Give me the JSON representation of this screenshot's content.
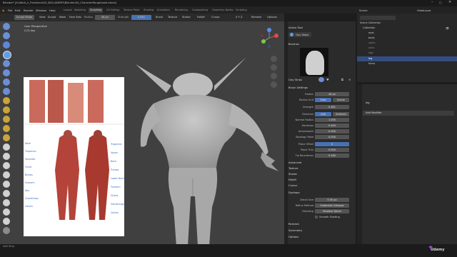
{
  "titlebar": {
    "title": "Blender* [A:\\Work_n_Freelance\\00_SKILLADEMY\\Blender\\04_CharacterRough\\bold.blend]"
  },
  "menubar": {
    "items": [
      "File",
      "Edit",
      "Render",
      "Window",
      "Help"
    ],
    "workspaces": [
      "Layout",
      "Modeling",
      "Sculpting",
      "UV Editing",
      "Texture Paint",
      "Shading",
      "Animation",
      "Rendering",
      "Compositing",
      "Geometry Nodes",
      "Scripting"
    ],
    "active_workspace": "Sculpting",
    "scene_label": "Scene",
    "viewlayer_label": "ViewLayer"
  },
  "header": {
    "mode": "Sculpt Mode",
    "view": "View",
    "sculpt": "Sculpt",
    "mask": "Mask",
    "face_sets": "Face Sets",
    "radius_label": "Radius",
    "radius_value": "46 px",
    "strength_label": "Strength",
    "strength_value": "0.481",
    "brush": "Brush",
    "texture": "Texture",
    "stroke": "Stroke",
    "falloff": "Falloff",
    "cursor": "Cursor",
    "xyz": "X Y Z",
    "remesh": "Remesh",
    "options": "Options"
  },
  "viewport": {
    "view_name": "User Perspective",
    "object_name": "(13) leg"
  },
  "props": {
    "active_tool": "Active Tool",
    "tool_name": "Clay Strips",
    "brushes_section": "Brushes",
    "brush_name": "Clay Strips",
    "brush_settings": "Brush Settings",
    "radius_label": "Radius",
    "radius_value": "46 px",
    "radius_unit_label": "Radius Unit",
    "radius_unit_view": "View",
    "radius_unit_scene": "Scene",
    "strength_label": "Strength",
    "strength_value": "0.481",
    "direction_label": "Direction",
    "direction_add": "Add",
    "direction_subtract": "Subtract",
    "normal_radius_label": "Normal Radius",
    "normal_radius_value": "1.000",
    "hardness_label": "Hardness",
    "hardness_value": "0.400",
    "autosmooth_label": "Autosmooth",
    "autosmooth_value": "0.000",
    "topology_rake_label": "Topology Rake",
    "topology_rake_value": "0.000",
    "plane_offset_label": "Plane Offset",
    "plane_offset_value": "0",
    "plane_trim_label": "Plane Trim",
    "plane_trim_value": "0.500",
    "tip_roundness_label": "Tip Roundness",
    "tip_roundness_value": "0.180",
    "advanced": "Advanced",
    "texture": "Texture",
    "stroke": "Stroke",
    "falloff": "Falloff",
    "cursor": "Cursor",
    "dyntopo": "Dyntopo",
    "detail_size_label": "Detail Size",
    "detail_size_value": "5.00 px",
    "refine_method_label": "Refine Method",
    "refine_method_value": "Subdivide Collapse",
    "detailing_label": "Detailing",
    "detailing_value": "Relative Detail",
    "smooth_shading": "Smooth Shading",
    "remesh": "Remesh",
    "symmetry": "Symmetry",
    "options": "Options"
  },
  "outliner": {
    "scene_collection": "Scene Collection",
    "items": [
      {
        "name": "Collection"
      },
      {
        "name": "eyeL"
      },
      {
        "name": "body"
      },
      {
        "name": "spine"
      },
      {
        "name": "neck"
      },
      {
        "name": "legL"
      },
      {
        "name": "leg"
      },
      {
        "name": "torso"
      }
    ]
  },
  "modifiers": {
    "object_name": "leg",
    "add_modifier": "Add Modifier"
  },
  "statusbar": {
    "left_text": "Add Strip",
    "brand": "Udemy"
  },
  "reference": {
    "labels_left": [
      "Neck",
      "Trapezius",
      "Shoulder",
      "Chest",
      "Biceps",
      "Forearm",
      "Abs",
      "Quadriceps",
      "Calves"
    ],
    "labels_right": [
      "Trapezius",
      "Upper Back",
      "Triceps",
      "Lower Back",
      "Forearm",
      "Glutes",
      "Hamstrings",
      "Calves"
    ]
  },
  "colors": {
    "accent": "#4772b3",
    "active_workspace": "#3d3d3d",
    "viewport_bg": "#404040"
  }
}
